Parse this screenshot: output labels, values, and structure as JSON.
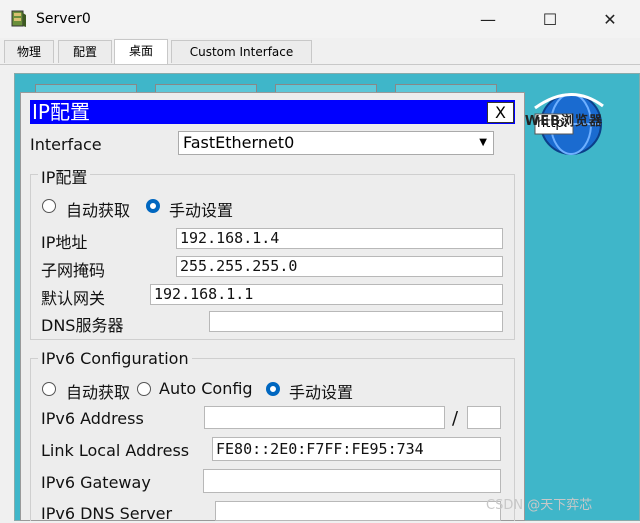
{
  "window": {
    "title": "Server0",
    "minimize": "—",
    "maximize": "☐",
    "close": "✕"
  },
  "tabs": [
    "物理",
    "配置",
    "桌面",
    "Custom Interface"
  ],
  "desktop": {
    "web_browser_label": "WEB浏览器",
    "http_badge": "http:"
  },
  "dialog": {
    "title": "IP配置",
    "close_label": "X",
    "interface_label": "Interface",
    "interface_value": "FastEthernet0",
    "ipv4": {
      "group_label": "IP配置",
      "dhcp_label": "自动获取",
      "static_label": "手动设置",
      "ip_label": "IP地址",
      "ip_value": "192.168.1.4",
      "mask_label": "子网掩码",
      "mask_value": "255.255.255.0",
      "gateway_label": "默认网关",
      "gateway_value": "192.168.1.1",
      "dns_label": "DNS服务器",
      "dns_value": ""
    },
    "ipv6": {
      "group_label": "IPv6 Configuration",
      "dhcp_label": "自动获取",
      "auto_label": "Auto Config",
      "static_label": "手动设置",
      "address_label": "IPv6 Address",
      "address_value": "",
      "prefix_sep": "/",
      "prefix_value": "",
      "link_local_label": "Link Local Address",
      "link_local_value": "FE80::2E0:F7FF:FE95:734",
      "gateway_label": "IPv6 Gateway",
      "gateway_value": "",
      "dns_label": "IPv6 DNS Server",
      "dns_value": ""
    }
  },
  "watermark": "CSDN @天下弈芯"
}
